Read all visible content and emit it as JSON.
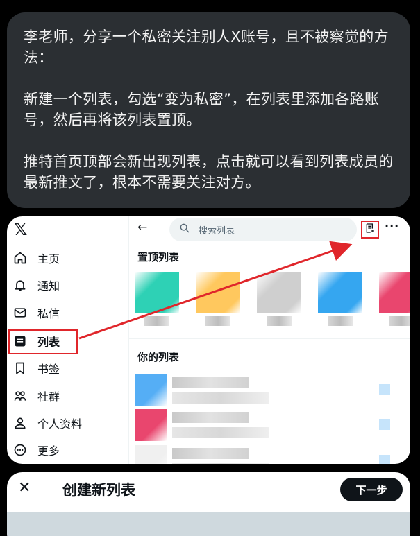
{
  "message": {
    "paragraphs": [
      "李老师，分享一个私密关注别人X账号，且不被察觉的方法：",
      "新建一个列表，勾选“变为私密”，在列表里添加各路账号，然后再将该列表置顶。",
      "推特首页顶部会新出现列表，点击就可以看到列表成员的最新推文了，根本不需要关注对方。"
    ]
  },
  "sidebar": {
    "logo": "𝕏",
    "items": [
      {
        "label": "主页",
        "icon": "home-icon"
      },
      {
        "label": "通知",
        "icon": "bell-icon"
      },
      {
        "label": "私信",
        "icon": "envelope-icon"
      },
      {
        "label": "列表",
        "icon": "list-icon",
        "active": true
      },
      {
        "label": "书签",
        "icon": "bookmark-icon"
      },
      {
        "label": "社群",
        "icon": "people-icon"
      },
      {
        "label": "个人资料",
        "icon": "person-icon"
      },
      {
        "label": "更多",
        "icon": "more-circle-icon"
      }
    ]
  },
  "lists_page": {
    "search_placeholder": "搜索列表",
    "pinned_title": "置顶列表",
    "your_lists_title": "你的列表",
    "pinned_colors": [
      "#2ed1b5",
      "#ffc85e",
      "#cfcfcf",
      "#35a6f0",
      "#e9466e"
    ],
    "list_avatar_colors": [
      "#55aef5",
      "#e9466e",
      "#f0f0f0"
    ]
  },
  "create_dialog": {
    "title": "创建新列表",
    "next_label": "下一步"
  },
  "colors": {
    "annotation_red": "#e0262b",
    "bubble_bg": "#2b2f33"
  }
}
